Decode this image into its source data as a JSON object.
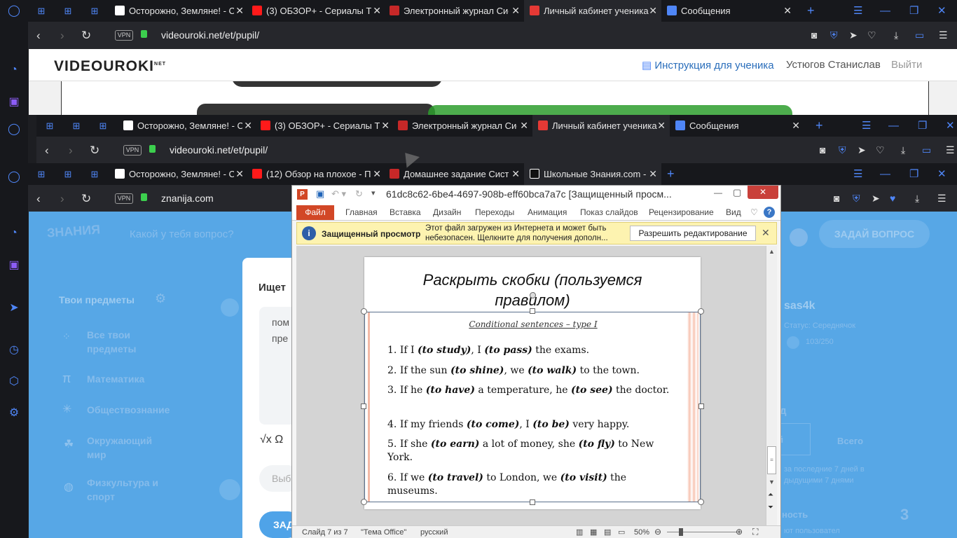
{
  "browser": {
    "tabs_common": [
      "Осторожно, Земляне! - Се",
      "(3) ОБЗОР+ - Сериалы ТН",
      "Электронный журнал Сис",
      "Личный кабинет ученика",
      "Сообщения"
    ],
    "tabs_third": [
      "Осторожно, Земляне! - Се",
      "(12) Обзор на плохое - Па",
      "Домашнее задание Систе",
      "Школьные Знания.com - Р"
    ],
    "url_videouroki": "videouroki.net/et/pupil/",
    "url_znanija": "znanija.com",
    "vpn": "VPN",
    "close": "✕",
    "add": "+"
  },
  "videouroki": {
    "logo": "VIDEOUROKI",
    "logo_suffix": "NET",
    "instructions": "Инструкция для ученика",
    "user": "Устюгов Станислав",
    "logout": "Выйти"
  },
  "znanija": {
    "logo": "ЗНАНИЯ",
    "search_placeholder": "Какой у тебя вопрос?",
    "ask": "ЗАДАЙ ВОПРОС",
    "subjects_title": "Твои предметы",
    "subjects": [
      "Все твои предметы",
      "Математика",
      "Обществознание",
      "Окружающий мир",
      "Физкультура и спорт"
    ],
    "card_title": "Ищет",
    "card_text1": "пом",
    "card_text2": "пре",
    "tools": "√x  Ω",
    "choose": "Выб",
    "submit": "ЗАД",
    "username": "sas4k",
    "status": "Статус: Середнячок",
    "points": "103/250",
    "tab_all": "Всего",
    "week_text1": "за последние 7 дней в",
    "week_text2": "дыдущими 7 днями",
    "section": "д",
    "section2": "й",
    "activity": "ность",
    "number": "3",
    "foot": "ют пользовател"
  },
  "ppt": {
    "title": "61dc8c62-6be4-4697-908b-eff60bca7a7c [Защищенный просм...",
    "ribbon_file": "Файл",
    "ribbon_tabs": [
      "Главная",
      "Вставка",
      "Дизайн",
      "Переходы",
      "Анимация",
      "Показ слайдов",
      "Рецензирование",
      "Вид"
    ],
    "warn_title": "Защищенный просмотр",
    "warn_text1": "Этот файл загружен из Интернета и может быть",
    "warn_text2": "небезопасен. Щелкните для получения дополн...",
    "enable_edit": "Разрешить редактирование",
    "slide_title": "Раскрыть скобки (пользуемся правилом)",
    "slide_subtitle": "Conditional sentences – type I",
    "items": [
      {
        "n": "1.",
        "parts": [
          [
            "If I ",
            0
          ],
          [
            "(to study)",
            1
          ],
          [
            ", I ",
            0
          ],
          [
            "(to pass)",
            1
          ],
          [
            " the exams.",
            0
          ]
        ]
      },
      {
        "n": "2.",
        "parts": [
          [
            "If the sun ",
            0
          ],
          [
            "(to shine)",
            1
          ],
          [
            ", we ",
            0
          ],
          [
            "(to walk)",
            1
          ],
          [
            " to the town.",
            0
          ]
        ]
      },
      {
        "n": "3.",
        "parts": [
          [
            "If he ",
            0
          ],
          [
            "(to have)",
            1
          ],
          [
            " a temperature, he ",
            0
          ],
          [
            "(to see)",
            1
          ],
          [
            " the doctor.",
            0
          ]
        ]
      },
      {
        "n": "4.",
        "parts": [
          [
            "If my friends ",
            0
          ],
          [
            "(to come)",
            1
          ],
          [
            ", I ",
            0
          ],
          [
            "(to be)",
            1
          ],
          [
            " very happy.",
            0
          ]
        ]
      },
      {
        "n": "5.",
        "parts": [
          [
            "If she ",
            0
          ],
          [
            "(to earn)",
            1
          ],
          [
            " a lot of money, she ",
            0
          ],
          [
            "(to fly)",
            1
          ],
          [
            " to New York.",
            0
          ]
        ]
      },
      {
        "n": "6.",
        "parts": [
          [
            "If we ",
            0
          ],
          [
            "(to travel)",
            1
          ],
          [
            " to London, we ",
            0
          ],
          [
            "(to visit)",
            1
          ],
          [
            " the museums.",
            0
          ]
        ]
      }
    ],
    "status_slide": "Слайд 7 из 7",
    "status_theme": "\"Тема Office\"",
    "status_lang": "русский",
    "zoom": "50%"
  }
}
